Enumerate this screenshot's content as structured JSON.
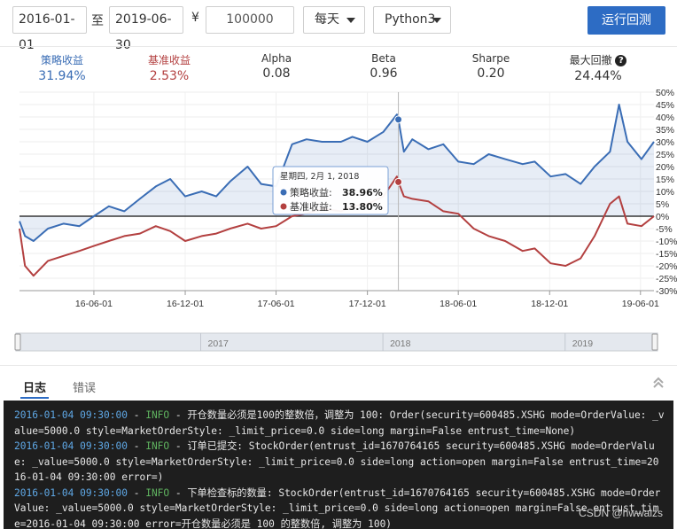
{
  "toolbar": {
    "start_date": "2016-01-01",
    "to_label": "至",
    "end_date": "2019-06-30",
    "currency_symbol": "¥",
    "capital": "100000",
    "frequency": "每天",
    "language": "Python3",
    "run_button": "运行回测"
  },
  "stats": [
    {
      "label": "策略收益",
      "value": "31.94%"
    },
    {
      "label": "基准收益",
      "value": "2.53%"
    },
    {
      "label": "Alpha",
      "value": "0.08"
    },
    {
      "label": "Beta",
      "value": "0.96"
    },
    {
      "label": "Sharpe",
      "value": "0.20"
    },
    {
      "label": "最大回撤",
      "value": "24.44%"
    }
  ],
  "colors": {
    "strategy": "#3a6db5",
    "benchmark": "#b34040",
    "accent": "#2d6cc4"
  },
  "chart_data": {
    "type": "line",
    "x_tick_labels": [
      "16-06-01",
      "16-12-01",
      "17-06-01",
      "17-12-01",
      "18-06-01",
      "18-12-01",
      "19-06-01"
    ],
    "y_tick_labels": [
      "50%",
      "45%",
      "40%",
      "35%",
      "30%",
      "25%",
      "20%",
      "15%",
      "10%",
      "5%",
      "0%",
      "-5%",
      "-10%",
      "-15%",
      "-20%",
      "-25%",
      "-30%"
    ],
    "ylim": [
      -30,
      50
    ],
    "x_start": "2016-01-04",
    "x_end": "2019-06-28",
    "grid": true,
    "series": [
      {
        "name": "策略收益",
        "x": [
          "2016-01-04",
          "2016-01-15",
          "2016-02-01",
          "2016-03-01",
          "2016-04-01",
          "2016-05-03",
          "2016-06-01",
          "2016-07-01",
          "2016-08-01",
          "2016-09-01",
          "2016-10-03",
          "2016-11-01",
          "2016-12-01",
          "2017-01-03",
          "2017-02-01",
          "2017-03-01",
          "2017-04-05",
          "2017-05-02",
          "2017-06-01",
          "2017-07-03",
          "2017-08-01",
          "2017-09-01",
          "2017-10-09",
          "2017-11-01",
          "2017-12-01",
          "2018-01-02",
          "2018-01-29",
          "2018-02-01",
          "2018-02-12",
          "2018-03-01",
          "2018-04-02",
          "2018-05-02",
          "2018-06-01",
          "2018-07-02",
          "2018-08-01",
          "2018-09-03",
          "2018-10-08",
          "2018-11-01",
          "2018-12-03",
          "2019-01-02",
          "2019-02-01",
          "2019-03-01",
          "2019-04-01",
          "2019-04-19",
          "2019-05-06",
          "2019-06-03",
          "2019-06-28"
        ],
        "y": [
          -2,
          -8,
          -10,
          -5,
          -3,
          -4,
          0,
          4,
          2,
          7,
          12,
          15,
          8,
          10,
          8,
          14,
          20,
          13,
          12,
          29,
          31,
          30,
          30,
          32,
          30,
          34,
          41,
          38.96,
          26,
          31,
          27,
          29,
          22,
          21,
          25,
          23,
          21,
          22,
          16,
          17,
          13,
          20,
          26,
          45,
          30,
          23,
          30
        ]
      },
      {
        "name": "基准收益",
        "x": [
          "2016-01-04",
          "2016-01-15",
          "2016-02-01",
          "2016-03-01",
          "2016-04-01",
          "2016-05-03",
          "2016-06-01",
          "2016-07-01",
          "2016-08-01",
          "2016-09-01",
          "2016-10-03",
          "2016-11-01",
          "2016-12-01",
          "2017-01-03",
          "2017-02-01",
          "2017-03-01",
          "2017-04-05",
          "2017-05-02",
          "2017-06-01",
          "2017-07-03",
          "2017-08-01",
          "2017-09-01",
          "2017-10-09",
          "2017-11-01",
          "2017-12-01",
          "2018-01-02",
          "2018-01-29",
          "2018-02-01",
          "2018-02-12",
          "2018-03-01",
          "2018-04-02",
          "2018-05-02",
          "2018-06-01",
          "2018-07-02",
          "2018-08-01",
          "2018-09-03",
          "2018-10-08",
          "2018-11-01",
          "2018-12-03",
          "2019-01-02",
          "2019-02-01",
          "2019-03-01",
          "2019-04-01",
          "2019-04-19",
          "2019-05-06",
          "2019-06-03",
          "2019-06-28"
        ],
        "y": [
          -5,
          -20,
          -24,
          -18,
          -16,
          -14,
          -12,
          -10,
          -8,
          -7,
          -4,
          -6,
          -10,
          -8,
          -7,
          -5,
          -3,
          -5,
          -4,
          0,
          1,
          3,
          2,
          4,
          5,
          8,
          16,
          13.8,
          8,
          7,
          6,
          2,
          1,
          -5,
          -8,
          -10,
          -14,
          -13,
          -19,
          -20,
          -17,
          -8,
          5,
          8,
          -3,
          -4,
          0
        ]
      }
    ],
    "tooltip": {
      "date": "星期四, 2月 1, 2018",
      "strategy_label": "策略收益:",
      "strategy_value": "38.96%",
      "benchmark_label": "基准收益:",
      "benchmark_value": "13.80%"
    },
    "navigator_years": [
      "2017",
      "2018",
      "2019"
    ]
  },
  "tabs": {
    "log": "日志",
    "errors": "错误"
  },
  "log_lines": [
    {
      "ts": "2016-01-04 09:30:00",
      "dash": " - ",
      "level": "INFO",
      "msg": "  - 开仓数量必须是100的整数倍，调整为 100: Order(security=600485.XSHG mode=OrderValue: _value=5000.0 style=MarketOrderStyle: _limit_price=0.0 side=long margin=False entrust_time=None)"
    },
    {
      "ts": "2016-01-04 09:30:00",
      "dash": " - ",
      "level": "INFO",
      "msg": "  - 订单已提交: StockOrder(entrust_id=1670764165 security=600485.XSHG mode=OrderValue: _value=5000.0 style=MarketOrderStyle: _limit_price=0.0 side=long action=open margin=False entrust_time=2016-01-04 09:30:00 error=)"
    },
    {
      "ts": "2016-01-04 09:30:00",
      "dash": " - ",
      "level": "INFO",
      "msg": "  - 下单检查标的数量: StockOrder(entrust_id=1670764165 security=600485.XSHG mode=OrderValue: _value=5000.0 style=MarketOrderStyle: _limit_price=0.0 side=long action=open margin=False entrust_time=2016-01-04 09:30:00 error=开仓数量必须是 100 的整数倍, 调整为 100)"
    }
  ],
  "watermark": "CSDN @hwwaizs"
}
